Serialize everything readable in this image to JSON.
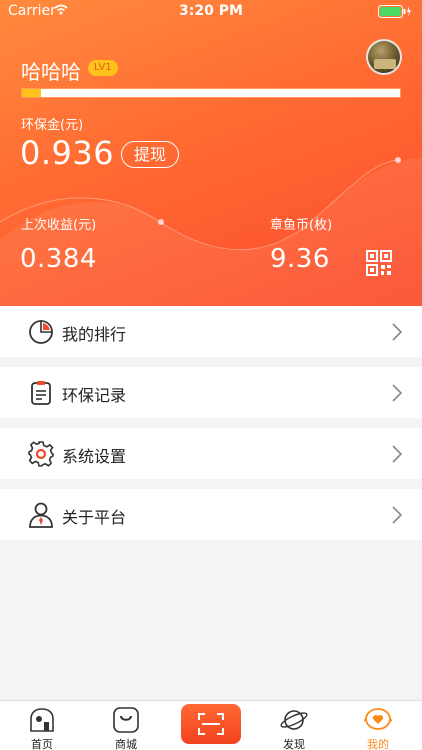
{
  "status_bar": {
    "carrier": "Carrier",
    "time": "3:20 PM"
  },
  "profile": {
    "name": "哈哈哈",
    "level": "LV1",
    "level_progress": 0.05
  },
  "wallet": {
    "eco_gold_label": "环保金(元)",
    "eco_gold_value": "0.936",
    "withdraw_label": "提现",
    "last_income_label": "上次收益(元)",
    "last_income_value": "0.384",
    "coins_label": "章鱼币(枚)",
    "coins_value": "9.36"
  },
  "menu": [
    {
      "label": "我的排行",
      "icon": "ranking-chart-icon"
    },
    {
      "label": "环保记录",
      "icon": "clipboard-icon"
    },
    {
      "label": "系统设置",
      "icon": "gear-icon"
    },
    {
      "label": "关于平台",
      "icon": "user-icon"
    }
  ],
  "tabs": [
    {
      "label": "首页",
      "icon": "home-icon"
    },
    {
      "label": "商城",
      "icon": "shop-icon"
    },
    {
      "label": "发现",
      "icon": "planet-icon"
    },
    {
      "label": "我的",
      "icon": "octopus-icon",
      "active": true
    }
  ],
  "colors": {
    "accent": "#ff6a32",
    "active_tab": "#ff8a1a",
    "badge": "#ffc21a"
  }
}
